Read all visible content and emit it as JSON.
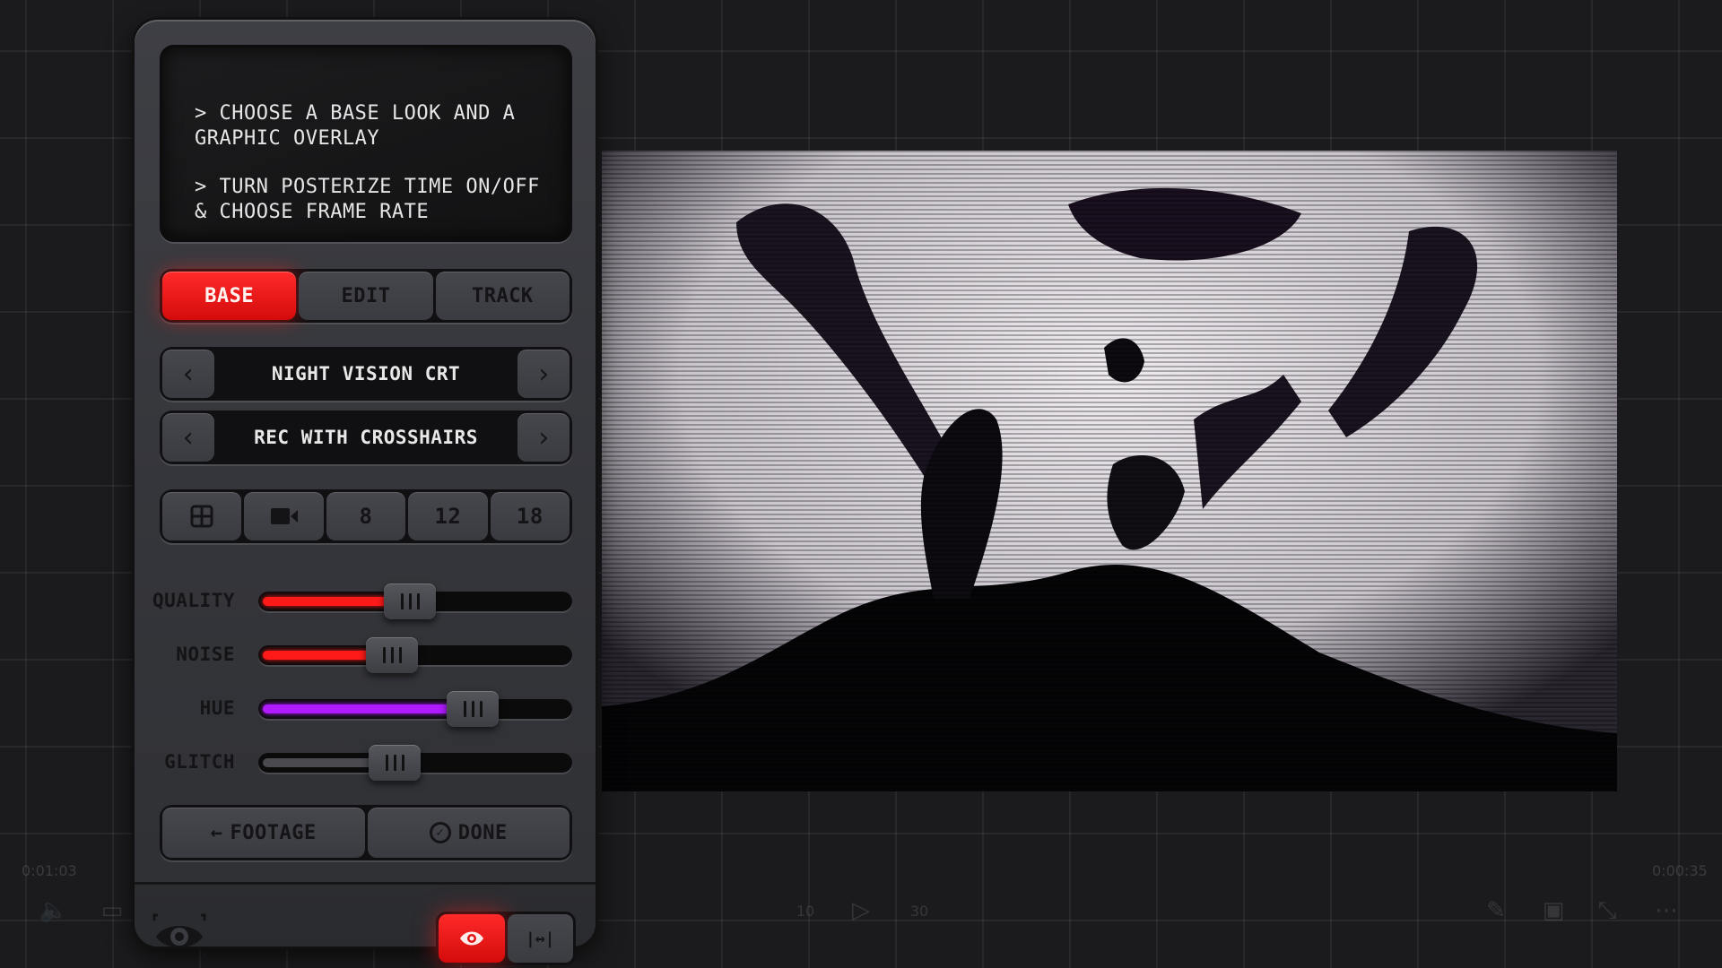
{
  "instructions": {
    "line1": "> CHOOSE A BASE LOOK AND A GRAPHIC OVERLAY",
    "line2": "> TURN POSTERIZE TIME ON/OFF & CHOOSE FRAME RATE"
  },
  "tabs": [
    {
      "label": "BASE",
      "active": true
    },
    {
      "label": "EDIT",
      "active": false
    },
    {
      "label": "TRACK",
      "active": false
    }
  ],
  "selectors": {
    "base_look": {
      "value": "NIGHT VISION CRT",
      "prev_icon": "chevron-left",
      "next_icon": "chevron-right"
    },
    "overlay": {
      "value": "REC WITH CROSSHAIRS",
      "prev_icon": "chevron-left",
      "next_icon": "chevron-right"
    }
  },
  "frame_rate": {
    "options": [
      {
        "icon": "grid-icon",
        "label": ""
      },
      {
        "icon": "video-camera-icon",
        "label": ""
      },
      {
        "label": "8"
      },
      {
        "label": "12"
      },
      {
        "label": "18"
      }
    ]
  },
  "sliders": [
    {
      "label": "QUALITY",
      "value": 0.48,
      "color": "#ff1a1a"
    },
    {
      "label": "NOISE",
      "value": 0.41,
      "color": "#ff1a1a"
    },
    {
      "label": "HUE",
      "value": 0.72,
      "color": "#b01aff"
    },
    {
      "label": "GLITCH",
      "value": 0.42,
      "color": "#4a4a4f"
    }
  ],
  "actions": {
    "footage_label": "FOOTAGE",
    "footage_icon": "←",
    "done_label": "DONE",
    "done_icon": "✓"
  },
  "footer": {
    "preview_toggle_icon": "eye-focus-icon",
    "modes": [
      {
        "icon": "eye-icon",
        "active": true
      },
      {
        "icon": "fit-width-icon",
        "label": "|↔|",
        "active": false
      }
    ]
  },
  "player": {
    "elapsed": "0:01:03",
    "remaining": "0:00:35",
    "rewind_label": "10",
    "forward_label": "30"
  },
  "colors": {
    "accent_red": "#ff1a1a",
    "hue_purple": "#b01aff",
    "panel": "#3a3b40"
  }
}
